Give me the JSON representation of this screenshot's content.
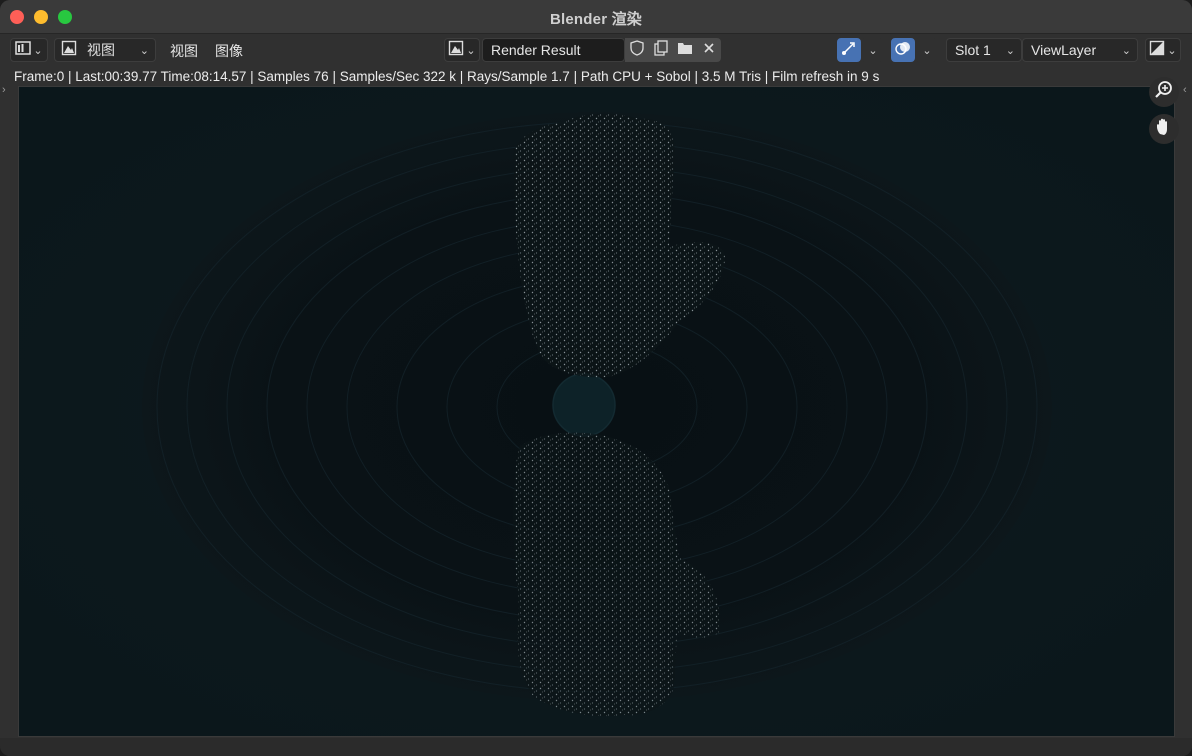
{
  "window": {
    "title": "Blender 渲染"
  },
  "header": {
    "editor_type_icon": "image-editor-icon",
    "view_mode_label": "视图",
    "menu_view": "视图",
    "menu_image": "图像",
    "image_name": "Render Result",
    "slot_label": "Slot 1",
    "layer_label": "ViewLayer"
  },
  "stats": {
    "text": "Frame:0 | Last:00:39.77 Time:08:14.57 | Samples 76 | Samples/Sec 322 k | Rays/Sample 1.7 | Path CPU + Sobol | 3.5 M Tris | Film refresh in 9 s"
  },
  "icons": {
    "fake_user": "shield-icon",
    "new_image": "new-image-icon",
    "open_image": "folder-icon",
    "unlink": "close-icon",
    "zoom": "zoom-icon",
    "pan": "hand-icon"
  },
  "colors": {
    "accent": "#4772b3",
    "viewport_bg": "#0c181c"
  }
}
